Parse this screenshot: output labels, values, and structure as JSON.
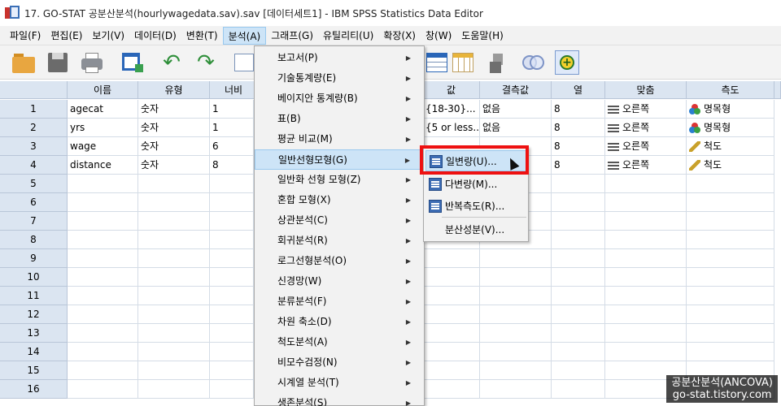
{
  "window": {
    "title": "17. GO-STAT 공분산분석(hourlywagedata.sav).sav [데이터세트1] - IBM SPSS Statistics Data Editor"
  },
  "menubar": [
    "파일(F)",
    "편집(E)",
    "보기(V)",
    "데이터(D)",
    "변환(T)",
    "분석(A)",
    "그래프(G)",
    "유틸리티(U)",
    "확장(X)",
    "창(W)",
    "도움말(H)"
  ],
  "columns": [
    "이름",
    "유형",
    "너비",
    "값",
    "결측값",
    "열",
    "맞춤",
    "측도"
  ],
  "rows": [
    {
      "num": "1",
      "name": "agecat",
      "type": "숫자",
      "width": "1",
      "values": "{18-30}...",
      "missing": "없음",
      "columns": "8",
      "align": "오른쪽",
      "measure": "명목형",
      "measure_kind": "nominal"
    },
    {
      "num": "2",
      "name": "yrs",
      "type": "숫자",
      "width": "1",
      "values": "{5 or less...",
      "missing": "없음",
      "columns": "8",
      "align": "오른쪽",
      "measure": "명목형",
      "measure_kind": "nominal"
    },
    {
      "num": "3",
      "name": "wage",
      "type": "숫자",
      "width": "6",
      "values": "",
      "missing": "",
      "columns": "8",
      "align": "오른쪽",
      "measure": "척도",
      "measure_kind": "scale"
    },
    {
      "num": "4",
      "name": "distance",
      "type": "숫자",
      "width": "8",
      "values": "",
      "missing": "",
      "columns": "8",
      "align": "오른쪽",
      "measure": "척도",
      "measure_kind": "scale"
    }
  ],
  "empty_row_numbers": [
    "5",
    "6",
    "7",
    "8",
    "9",
    "10",
    "11",
    "12",
    "13",
    "14",
    "15",
    "16"
  ],
  "analyze_menu": {
    "items": [
      {
        "label": "보고서(P)",
        "highlighted": false
      },
      {
        "label": "기술통계량(E)",
        "highlighted": false
      },
      {
        "label": "베이지안 통계량(B)",
        "highlighted": false
      },
      {
        "label": "표(B)",
        "highlighted": false
      },
      {
        "label": "평균 비교(M)",
        "highlighted": false
      },
      {
        "label": "일반선형모형(G)",
        "highlighted": true
      },
      {
        "label": "일반화 선형 모형(Z)",
        "highlighted": false
      },
      {
        "label": "혼합 모형(X)",
        "highlighted": false
      },
      {
        "label": "상관분석(C)",
        "highlighted": false
      },
      {
        "label": "회귀분석(R)",
        "highlighted": false
      },
      {
        "label": "로그선형분석(O)",
        "highlighted": false
      },
      {
        "label": "신경망(W)",
        "highlighted": false
      },
      {
        "label": "분류분석(F)",
        "highlighted": false
      },
      {
        "label": "차원 축소(D)",
        "highlighted": false
      },
      {
        "label": "척도분석(A)",
        "highlighted": false
      },
      {
        "label": "비모수검정(N)",
        "highlighted": false
      },
      {
        "label": "시계열 분석(T)",
        "highlighted": false
      },
      {
        "label": "생존분석(S)",
        "highlighted": false
      }
    ]
  },
  "glm_submenu": {
    "items": [
      {
        "label": "일변량(U)...",
        "has_icon": true,
        "highlighted": true
      },
      {
        "label": "다변량(M)...",
        "has_icon": true,
        "highlighted": false
      },
      {
        "label": "반복측도(R)...",
        "has_icon": true,
        "highlighted": false
      },
      {
        "label": "분산성분(V)...",
        "has_icon": false,
        "highlighted": false
      }
    ]
  },
  "watermark": {
    "line1": "공분산분석(ANCOVA)",
    "line2": "go-stat.tistory.com"
  },
  "colors": {
    "menu_highlight": "#cde4f7",
    "callout_border": "#ee1111",
    "header_bg": "#dbe5f1"
  }
}
